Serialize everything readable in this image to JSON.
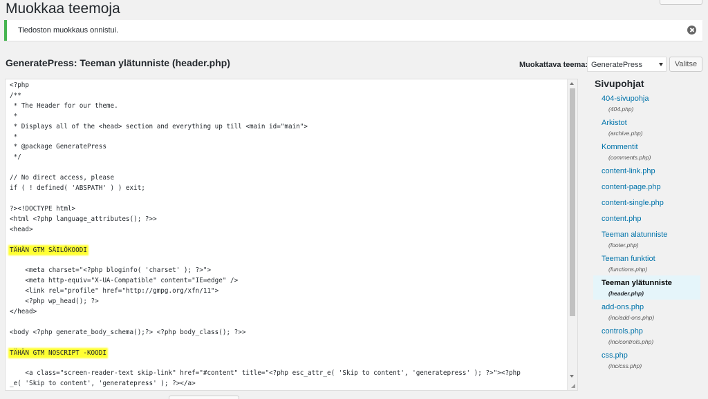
{
  "page_title": "Muokkaa teemoja",
  "notice": {
    "text": "Tiedoston muokkaus onnistui."
  },
  "file_heading": "GeneratePress: Teeman ylätunniste (header.php)",
  "theme_selector": {
    "label": "Muokattava teema:",
    "value": "GeneratePress",
    "button": "Valitse"
  },
  "code_lines": [
    "<?php",
    "/**",
    " * The Header for our theme.",
    " *",
    " * Displays all of the <head> section and everything up till <main id=\"main\">",
    " *",
    " * @package GeneratePress",
    " */",
    "",
    "// No direct access, please",
    "if ( ! defined( 'ABSPATH' ) ) exit;",
    "",
    "?><!DOCTYPE html>",
    "<html <?php language_attributes(); ?>>",
    "<head>",
    "",
    "TÄHÄN GTM SÄILÖKOODI",
    "",
    "    <meta charset=\"<?php bloginfo( 'charset' ); ?>\">",
    "    <meta http-equiv=\"X-UA-Compatible\" content=\"IE=edge\" />",
    "    <link rel=\"profile\" href=\"http://gmpg.org/xfn/11\">",
    "    <?php wp_head(); ?>",
    "</head>",
    "",
    "<body <?php generate_body_schema();?> <?php body_class(); ?>>",
    "",
    "TÄHÄN GTM NOSCRIPT -KOODI",
    "",
    "    <a class=\"screen-reader-text skip-link\" href=\"#content\" title=\"<?php esc_attr_e( 'Skip to content', 'generatepress' ); ?>\"><?php",
    "_e( 'Skip to content', 'generatepress' ); ?></a>"
  ],
  "highlighted_lines": [
    16,
    26
  ],
  "sidebar": {
    "heading": "Sivupohjat",
    "files": [
      {
        "label": "404-sivupohja",
        "file": "(404.php)"
      },
      {
        "label": "Arkistot",
        "file": "(archive.php)"
      },
      {
        "label": "Kommentit",
        "file": "(comments.php)"
      },
      {
        "label": "content-link.php",
        "file": ""
      },
      {
        "label": "content-page.php",
        "file": ""
      },
      {
        "label": "content-single.php",
        "file": ""
      },
      {
        "label": "content.php",
        "file": ""
      },
      {
        "label": "Teeman alatunniste",
        "file": "(footer.php)"
      },
      {
        "label": "Teeman funktiot",
        "file": "(functions.php)"
      },
      {
        "label": "Teeman ylätunniste",
        "file": "(header.php)",
        "active": true
      },
      {
        "label": "add-ons.php",
        "file": "(inc/add-ons.php)"
      },
      {
        "label": "controls.php",
        "file": "(inc/controls.php)"
      },
      {
        "label": "css.php",
        "file": "(inc/css.php)"
      }
    ]
  },
  "colors": {
    "link": "#0073aa",
    "success": "#46b450",
    "highlight": "#ffff33"
  },
  "icons": {
    "dismiss": "close-circle-icon"
  }
}
